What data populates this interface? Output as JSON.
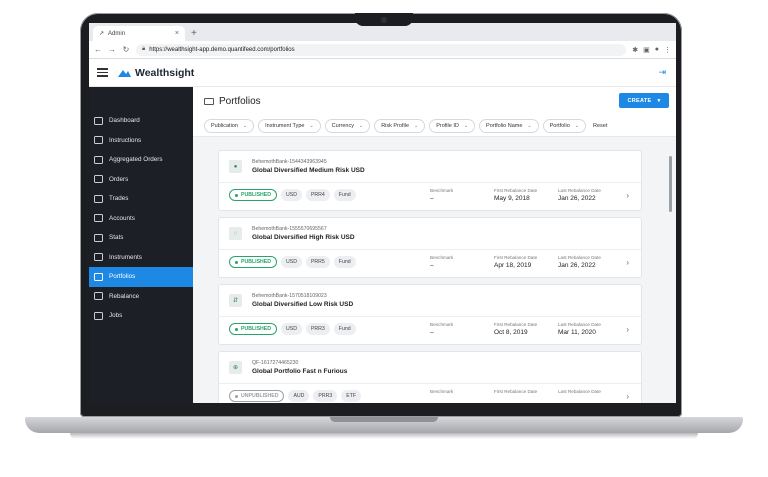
{
  "browser": {
    "tab_title": "Admin",
    "new_tab": "+",
    "url": "https://wealthsight-app.demo.quantifeed.com/portfolios"
  },
  "app": {
    "brand": "Wealthsight",
    "accent": "#1e88e5",
    "sidebar_bg": "#1c1f26"
  },
  "sidebar": {
    "items": [
      {
        "label": "Dashboard",
        "icon": "dashboard-icon"
      },
      {
        "label": "Instructions",
        "icon": "instructions-icon"
      },
      {
        "label": "Aggregated Orders",
        "icon": "aggregated-orders-icon"
      },
      {
        "label": "Orders",
        "icon": "orders-icon"
      },
      {
        "label": "Trades",
        "icon": "trades-icon"
      },
      {
        "label": "Accounts",
        "icon": "accounts-icon"
      },
      {
        "label": "Stats",
        "icon": "stats-icon"
      },
      {
        "label": "Instruments",
        "icon": "instruments-icon"
      },
      {
        "label": "Portfolios",
        "icon": "portfolios-icon",
        "active": true
      },
      {
        "label": "Rebalance",
        "icon": "rebalance-icon"
      },
      {
        "label": "Jobs",
        "icon": "jobs-icon"
      }
    ]
  },
  "page": {
    "title": "Portfolios",
    "create_label": "CREATE"
  },
  "filters": {
    "items": [
      "Publication",
      "Instrument Type",
      "Currency",
      "Risk Profile",
      "Profile ID",
      "Portfolio Name",
      "Portfolio"
    ],
    "reset_label": "Reset"
  },
  "labels": {
    "benchmark": "Benchmark",
    "first_rebalance": "First Rebalance Date",
    "last_rebalance": "Last Rebalance Date"
  },
  "portfolios": [
    {
      "id": "BehemothBank-1544343963945",
      "name": "Global Diversified Medium Risk USD",
      "status": "PUBLISHED",
      "tags": [
        "USD",
        "PRR4",
        "Fund"
      ],
      "benchmark": "–",
      "first_rebalance": "May 9, 2018",
      "last_rebalance": "Jan 26, 2022"
    },
    {
      "id": "BehemothBank-1555570695567",
      "name": "Global Diversified High Risk USD",
      "status": "PUBLISHED",
      "tags": [
        "USD",
        "PRR5",
        "Fund"
      ],
      "benchmark": "–",
      "first_rebalance": "Apr 18, 2019",
      "last_rebalance": "Jan 26, 2022"
    },
    {
      "id": "BehemothBank-1570518109023",
      "name": "Global Diversified Low Risk USD",
      "status": "PUBLISHED",
      "tags": [
        "USD",
        "PRR3",
        "Fund"
      ],
      "benchmark": "–",
      "first_rebalance": "Oct 8, 2019",
      "last_rebalance": "Mar 11, 2020"
    },
    {
      "id": "QF-1617274465230",
      "name": "Global Portfolio Fast n Furious",
      "status": "UNPUBLISHED",
      "tags": [
        "AUD",
        "PRR3",
        "ETF"
      ],
      "benchmark": "",
      "first_rebalance": "",
      "last_rebalance": ""
    }
  ]
}
